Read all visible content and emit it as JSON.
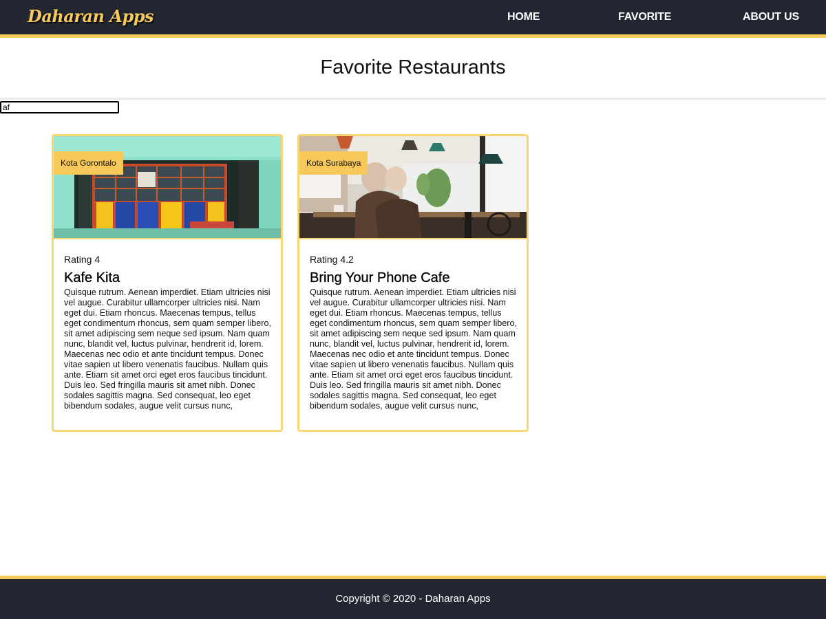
{
  "header": {
    "brand": "Daharan Apps",
    "nav": {
      "home": "HOME",
      "favorite": "FAVORITE",
      "about": "ABOUT US"
    }
  },
  "page": {
    "title": "Favorite Restaurants"
  },
  "search": {
    "value": "af"
  },
  "restaurants": [
    {
      "city": "Kota Gorontalo",
      "rating": "Rating 4",
      "name": "Kafe Kita",
      "description": "Quisque rutrum. Aenean imperdiet. Etiam ultricies nisi vel augue. Curabitur ullamcorper ultricies nisi. Nam eget dui. Etiam rhoncus. Maecenas tempus, tellus eget condimentum rhoncus, sem quam semper libero, sit amet adipiscing sem neque sed ipsum. Nam quam nunc, blandit vel, luctus pulvinar, hendrerit id, lorem. Maecenas nec odio et ante tincidunt tempus. Donec vitae sapien ut libero venenatis faucibus. Nullam quis ante. Etiam sit amet orci eget eros faucibus tincidunt. Duis leo. Sed fringilla mauris sit amet nibh. Donec sodales sagittis magna. Sed consequat, leo eget bibendum sodales, augue velit cursus nunc,"
    },
    {
      "city": "Kota Surabaya",
      "rating": "Rating 4.2",
      "name": "Bring Your Phone Cafe",
      "description": "Quisque rutrum. Aenean imperdiet. Etiam ultricies nisi vel augue. Curabitur ullamcorper ultricies nisi. Nam eget dui. Etiam rhoncus. Maecenas tempus, tellus eget condimentum rhoncus, sem quam semper libero, sit amet adipiscing sem neque sed ipsum. Nam quam nunc, blandit vel, luctus pulvinar, hendrerit id, lorem. Maecenas nec odio et ante tincidunt tempus. Donec vitae sapien ut libero venenatis faucibus. Nullam quis ante. Etiam sit amet orci eget eros faucibus tincidunt. Duis leo. Sed fringilla mauris sit amet nibh. Donec sodales sagittis magna. Sed consequat, leo eget bibendum sodales, augue velit cursus nunc,"
    }
  ],
  "footer": {
    "copyright": "Copyright © 2020 - Daharan Apps"
  },
  "colors": {
    "navbar": "#212630",
    "accent": "#f7c85a",
    "card_border": "#f7d774"
  }
}
